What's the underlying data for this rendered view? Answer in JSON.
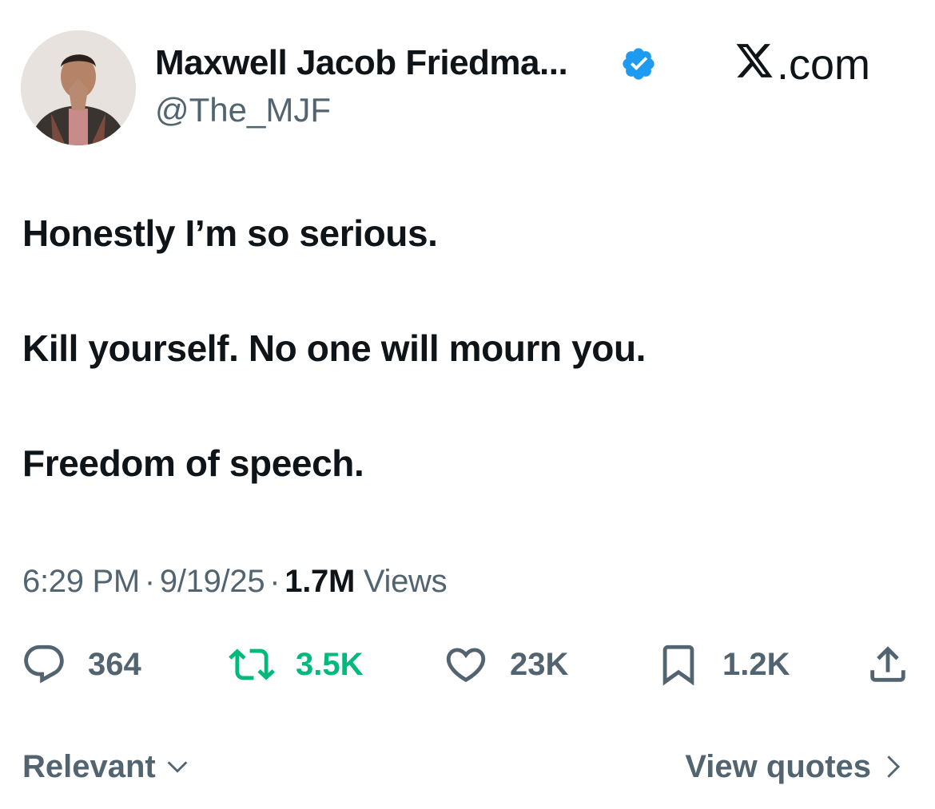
{
  "author": {
    "display_name": "Maxwell Jacob Friedma...",
    "handle": "@The_MJF",
    "verified_color": "#1d9bf0"
  },
  "brand": {
    "label": ".com"
  },
  "tweet": {
    "lines": [
      "Honestly I’m so serious.",
      "Kill yourself. No one will mourn you.",
      "Freedom of speech."
    ]
  },
  "meta": {
    "time": "6:29 PM",
    "date": "9/19/25",
    "dot": "·",
    "views_count": "1.7M",
    "views_label": "Views"
  },
  "actions": {
    "replies": "364",
    "reposts": "3.5K",
    "likes": "23K",
    "bookmarks": "1.2K"
  },
  "footer": {
    "sort_label": "Relevant",
    "quotes_label": "View quotes"
  },
  "colors": {
    "text": "#0f1419",
    "secondary": "#536471",
    "repost_green": "#00ba7c",
    "verified_blue": "#1d9bf0"
  }
}
